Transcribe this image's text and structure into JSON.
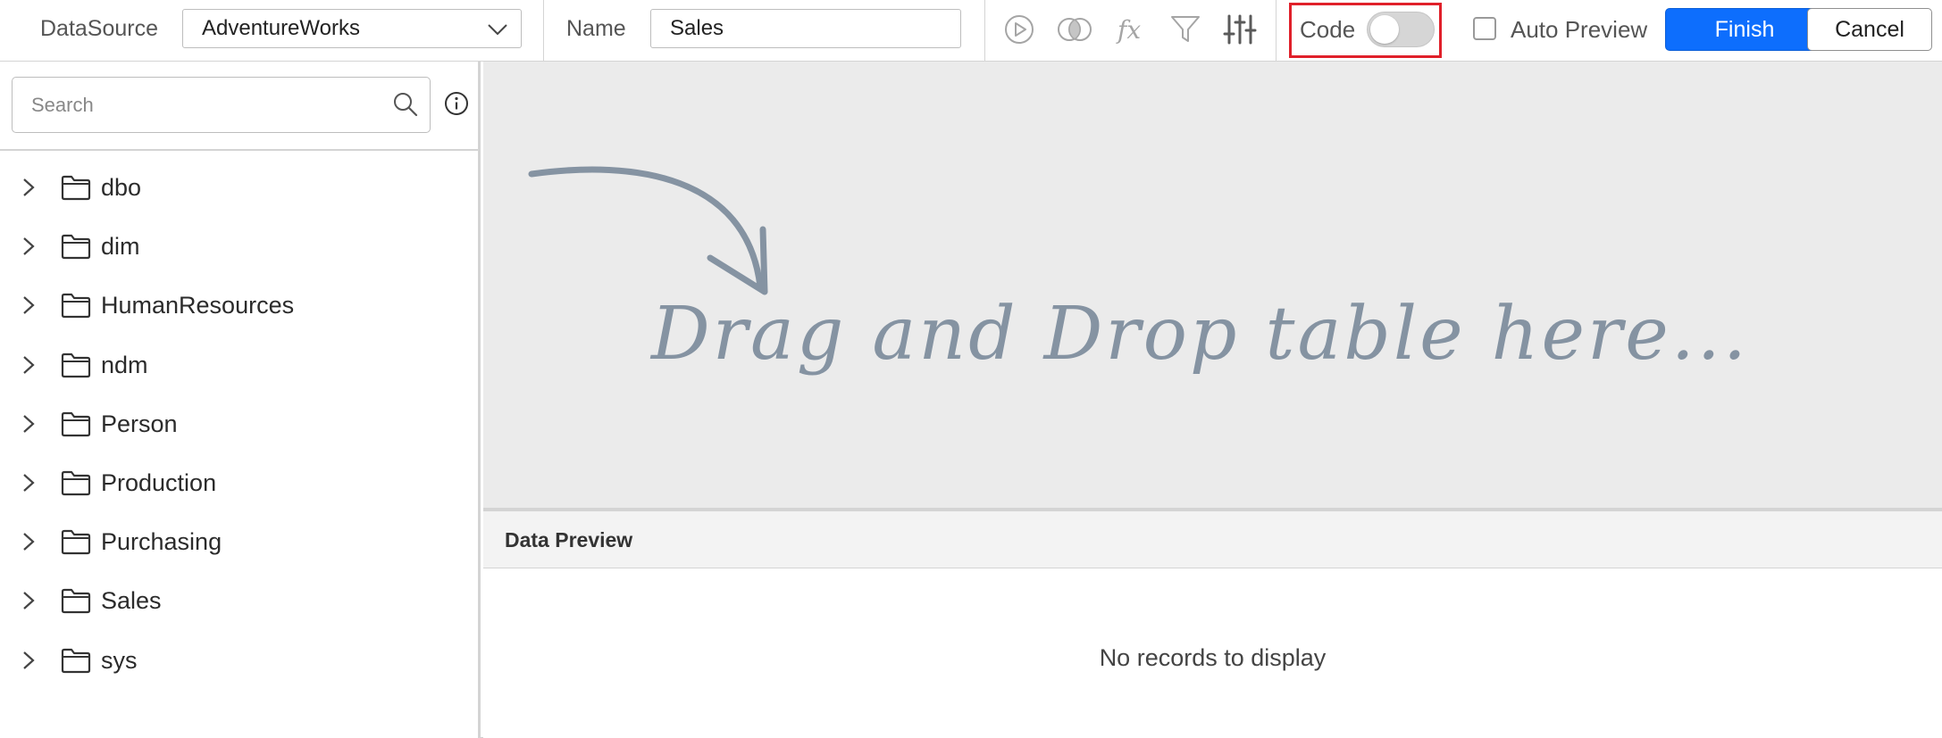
{
  "toolbar": {
    "datasource_label": "DataSource",
    "datasource_value": "AdventureWorks",
    "name_label": "Name",
    "name_value": "Sales",
    "icons": [
      "play-icon",
      "join-icon",
      "function-icon",
      "filter-icon",
      "settings-sliders-icon"
    ],
    "code_label": "Code",
    "code_toggle_on": false,
    "auto_preview_label": "Auto Preview",
    "auto_preview_checked": false,
    "finish_label": "Finish",
    "cancel_label": "Cancel"
  },
  "sidebar": {
    "search_placeholder": "Search",
    "items": [
      {
        "label": "dbo"
      },
      {
        "label": "dim"
      },
      {
        "label": "HumanResources"
      },
      {
        "label": "ndm"
      },
      {
        "label": "Person"
      },
      {
        "label": "Production"
      },
      {
        "label": "Purchasing"
      },
      {
        "label": "Sales"
      },
      {
        "label": "sys"
      }
    ]
  },
  "canvas": {
    "drop_hint": "Drag and Drop table here..."
  },
  "preview": {
    "title": "Data Preview",
    "empty_text": "No records to display"
  },
  "colors": {
    "accent": "#0d6efd",
    "highlight": "#e0202a",
    "canvas_bg": "#ebebeb",
    "hint": "#8593a2"
  }
}
